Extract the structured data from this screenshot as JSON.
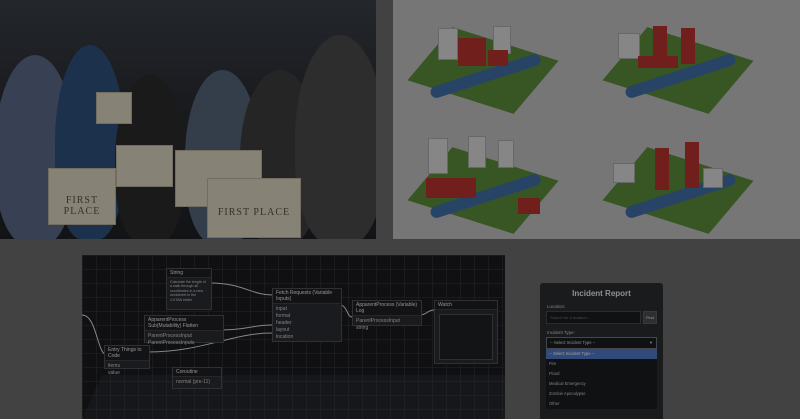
{
  "photo": {
    "certificate_text": "FIRST PLACE"
  },
  "graph": {
    "nodes": [
      {
        "title": "String",
        "body": "Calculate the length of a walk through all coordinates in a new worksheet in the CUTAN folder"
      },
      {
        "title": "Fetch Requests (Variable Inputs)",
        "ports": [
          "input",
          "format",
          "header",
          "layout",
          "location"
        ]
      },
      {
        "title": "ApparentProcess Sub(Mutability) Flatten",
        "ports": [
          "ParentProcessInput",
          "ParentProcessInputs"
        ]
      },
      {
        "title": "ApparentProcess (Variable) Log",
        "ports": [
          "ParentProcessInput",
          "string"
        ]
      },
      {
        "title": "Watch",
        "ports": []
      },
      {
        "title": "Entry Things to Code",
        "ports": [
          "items",
          "value"
        ]
      },
      {
        "title": "Coroutine",
        "ports": [
          "current"
        ]
      }
    ],
    "coroutine_value": "normal (pre-11)"
  },
  "incident": {
    "title": "Incident Report",
    "location_label": "Location:",
    "search_placeholder": "Search for a location...",
    "find_label": "Find",
    "type_label": "Incident Type:",
    "select_value": "-- Select Incident Type --",
    "options": [
      "-- Select Incident Type --",
      "Fire",
      "Flood",
      "Medical Emergency",
      "Zombie Apocalypse",
      "Other"
    ]
  }
}
